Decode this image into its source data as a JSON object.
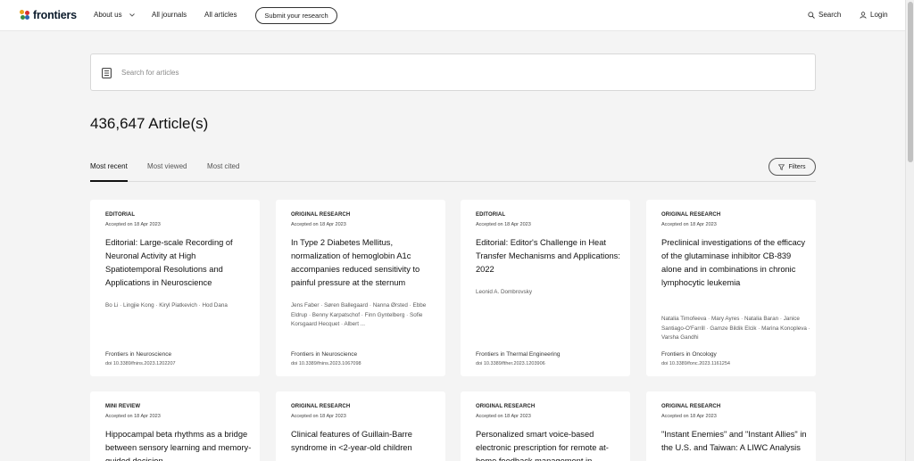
{
  "header": {
    "logo_text": "frontiers",
    "nav": {
      "about": "About us",
      "journals": "All journals",
      "articles": "All articles"
    },
    "submit_label": "Submit your research",
    "search_label": "Search",
    "login_label": "Login"
  },
  "search": {
    "placeholder": "Search for articles",
    "value": ""
  },
  "results": {
    "count_text": "436,647 Article(s)"
  },
  "tabs": [
    {
      "label": "Most recent",
      "active": true
    },
    {
      "label": "Most viewed",
      "active": false
    },
    {
      "label": "Most cited",
      "active": false
    }
  ],
  "filters_label": "Filters",
  "colors": {
    "accent": "#111111",
    "background": "#f4f4f4",
    "card": "#ffffff"
  },
  "cards": [
    {
      "type": "EDITORIAL",
      "date": "Accepted on 18 Apr 2023",
      "title": "Editorial: Large-scale Recording of Neuronal Activity at High Spatiotemporal Resolutions and Applications in Neuroscience",
      "authors": "Bo Li · Lingjie Kong · Kiryl Piatkevich · Hod Dana",
      "journal": "Frontiers in Neuroscience",
      "doi": "doi 10.3389/fnins.2023.1202207"
    },
    {
      "type": "ORIGINAL RESEARCH",
      "date": "Accepted on 18 Apr 2023",
      "title": "In Type 2 Diabetes Mellitus, normalization of hemoglobin A1c accompanies reduced sensitivity to painful pressure at the sternum",
      "authors": "Jens Faber · Søren Ballegaard · Nanna Ørsted · Ebbe Eldrup · Benny Karpatschof · Finn Gyntelberg · Sofie Korsgaard Hecquet · Albert ...",
      "journal": "Frontiers in Neuroscience",
      "doi": "doi 10.3389/fnins.2023.1067098"
    },
    {
      "type": "EDITORIAL",
      "date": "Accepted on 18 Apr 2023",
      "title": "Editorial: Editor's Challenge in Heat Transfer Mechanisms and Applications: 2022",
      "authors": "Leonid A. Dombrovsky",
      "journal": "Frontiers in Thermal Engineering",
      "doi": "doi 10.3389/fther.2023.1203906"
    },
    {
      "type": "ORIGINAL RESEARCH",
      "date": "Accepted on 18 Apr 2023",
      "title": "Preclinical investigations of the efficacy of the glutaminase inhibitor CB-839 alone and in combinations in chronic lymphocytic leukemia",
      "authors": "Natalia Timofeeva · Mary Ayres · Natalia Baran · Janice Santiago-O'Farrill · Gamze Bildik Elcik · Marina Konopleva · Varsha Gandhi",
      "journal": "Frontiers in Oncology",
      "doi": "doi 10.3389/fonc.2023.1161254"
    },
    {
      "type": "MINI REVIEW",
      "date": "Accepted on 18 Apr 2023",
      "title": "Hippocampal beta rhythms as a bridge between sensory learning and memory-guided decision",
      "authors": "",
      "journal": "",
      "doi": ""
    },
    {
      "type": "ORIGINAL RESEARCH",
      "date": "Accepted on 18 Apr 2023",
      "title": "Clinical features of Guillain-Barre syndrome in <2-year-old children",
      "authors": "",
      "journal": "",
      "doi": ""
    },
    {
      "type": "ORIGINAL RESEARCH",
      "date": "Accepted on 18 Apr 2023",
      "title": "Personalized smart voice-based electronic prescription for remote at-home feedback management in",
      "authors": "",
      "journal": "",
      "doi": ""
    },
    {
      "type": "ORIGINAL RESEARCH",
      "date": "Accepted on 18 Apr 2023",
      "title": "\"Instant Enemies\" and \"Instant Allies\" in the U.S. and Taiwan: A LIWC Analysis",
      "authors": "",
      "journal": "",
      "doi": ""
    }
  ]
}
